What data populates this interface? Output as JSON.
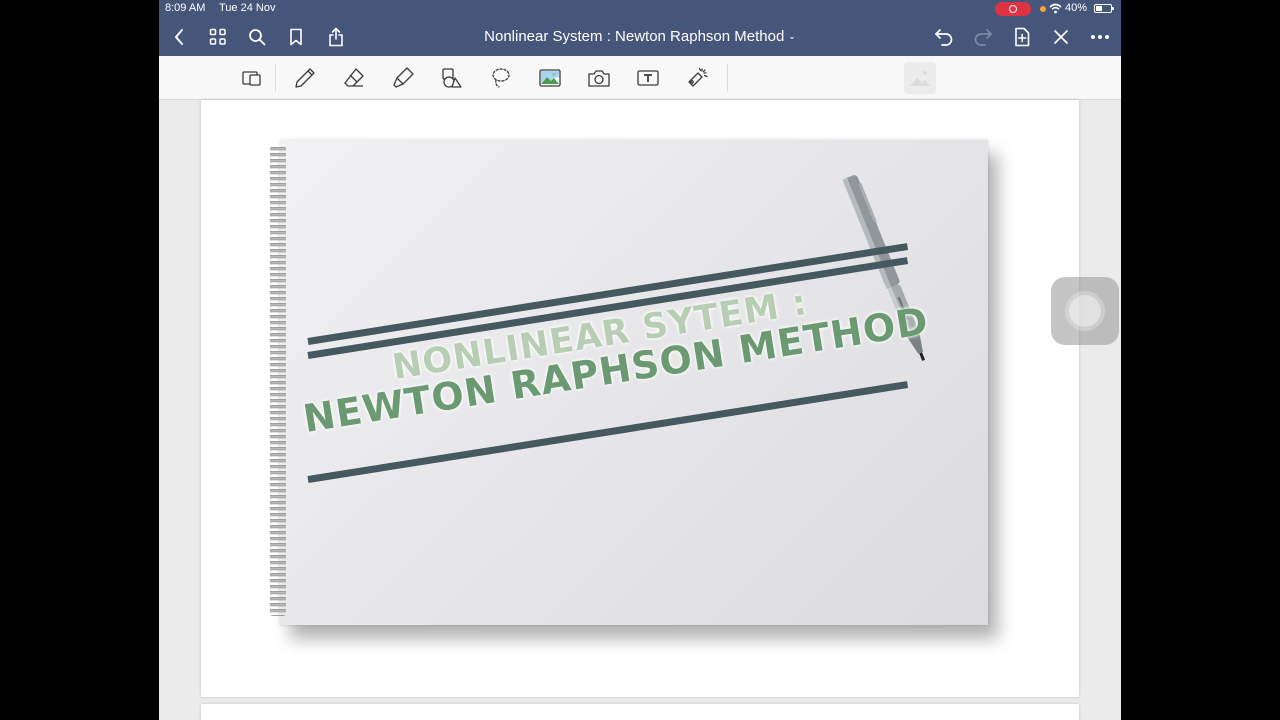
{
  "status_bar": {
    "time": "8:09 AM",
    "date": "Tue 24 Nov",
    "battery_percent": "40%"
  },
  "nav": {
    "document_title": "Nonlinear System : Newton Raphson Method",
    "left_icons": [
      "back-icon",
      "thumbnails-grid-icon",
      "search-icon",
      "bookmark-icon",
      "share-icon"
    ],
    "right_icons": [
      "undo-icon",
      "redo-icon",
      "add-page-icon",
      "close-icon",
      "more-icon"
    ]
  },
  "toolbar": {
    "tools": [
      "page-layout-icon",
      "pen-icon",
      "eraser-icon",
      "highlighter-icon",
      "shapes-icon",
      "lasso-icon",
      "image-icon",
      "camera-icon",
      "text-icon",
      "laser-pointer-icon"
    ]
  },
  "slide": {
    "heading_line1": "NONLINEAR SYTEM :",
    "heading_line2": "NEWTON RAPHSON METHOD"
  },
  "colors": {
    "nav_bar": "#46557a",
    "stripe": "#465961",
    "title_light_green": "#b7ceb4",
    "title_dark_green": "#6b9a72",
    "recording_indicator": "#e03341"
  }
}
